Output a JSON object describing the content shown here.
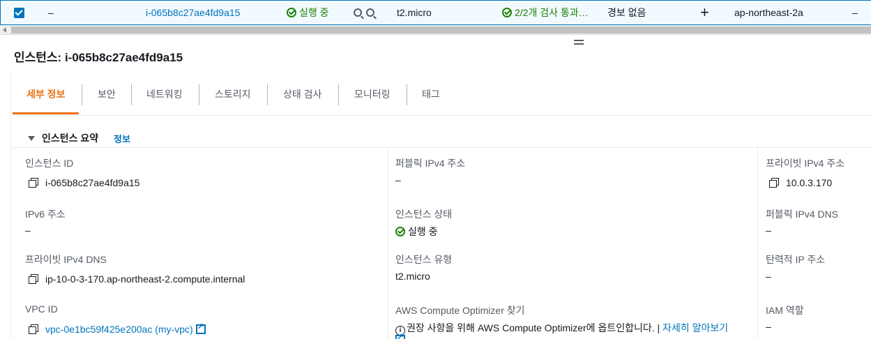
{
  "row": {
    "dash1": "–",
    "instance_id": "i-065b8c27ae4fd9a15",
    "state": "실행 중",
    "type": "t2.micro",
    "status_check": "2/2개 검사 통과…",
    "alarm": "경보 없음",
    "add": "+",
    "az": "ap-northeast-2a",
    "dash2": "–"
  },
  "title": "인스턴스: i-065b8c27ae4fd9a15",
  "tabs": [
    {
      "label": "세부 정보",
      "active": true
    },
    {
      "label": "보안"
    },
    {
      "label": "네트워킹"
    },
    {
      "label": "스토리지"
    },
    {
      "label": "상태 검사"
    },
    {
      "label": "모니터링"
    },
    {
      "label": "태그"
    }
  ],
  "summary": {
    "heading": "인스턴스 요약",
    "info": "정보"
  },
  "col1": {
    "instance_id_label": "인스턴스 ID",
    "instance_id_value": "i-065b8c27ae4fd9a15",
    "ipv6_label": "IPv6 주소",
    "ipv6_value": "–",
    "private_dns_label": "프라이빗 IPv4 DNS",
    "private_dns_value": "ip-10-0-3-170.ap-northeast-2.compute.internal",
    "vpc_label": "VPC ID",
    "vpc_value": "vpc-0e1bc59f425e200ac (my-vpc)"
  },
  "col2": {
    "public_ip_label": "퍼블릭 IPv4 주소",
    "public_ip_value": "–",
    "state_label": "인스턴스 상태",
    "state_value": "실행 중",
    "type_label": "인스턴스 유형",
    "type_value": "t2.micro",
    "optimizer_label": "AWS Compute Optimizer 찾기",
    "optimizer_text": "권장 사항을 위해 AWS Compute Optimizer에 옵트인합니다. |",
    "optimizer_link": "자세히 알아보기"
  },
  "col3": {
    "private_ip_label": "프라이빗 IPv4 주소",
    "private_ip_value": "10.0.3.170",
    "public_dns_label": "퍼블릭 IPv4 DNS",
    "public_dns_value": "–",
    "eip_label": "탄력적 IP 주소",
    "eip_value": "–",
    "iam_label": "IAM 역할",
    "iam_value": "–"
  }
}
